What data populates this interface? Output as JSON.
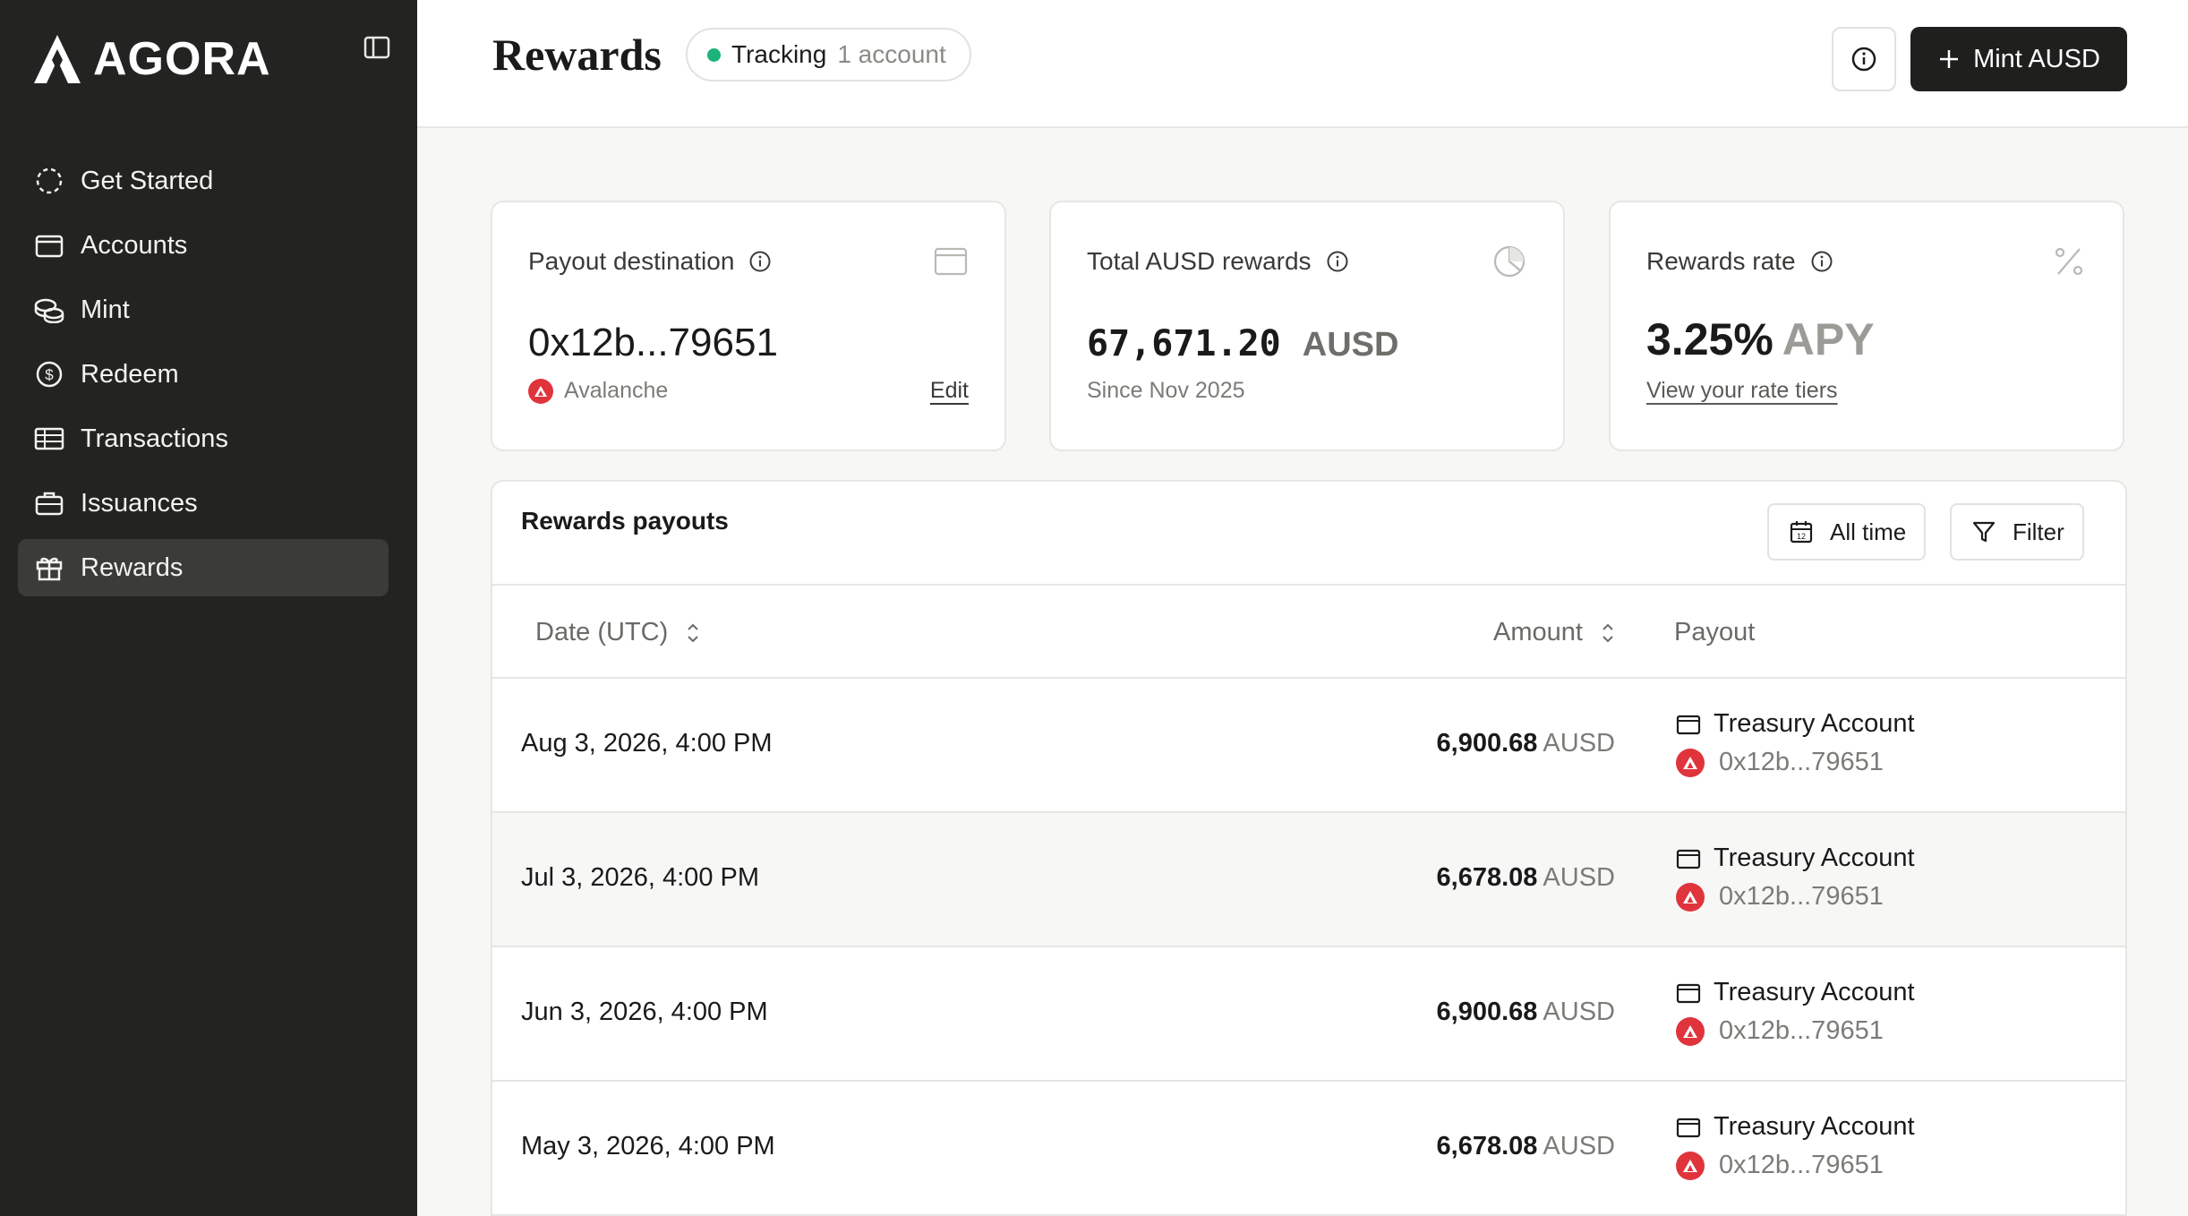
{
  "brand": {
    "name": "AGORA"
  },
  "sidebar": {
    "items": [
      {
        "label": "Get Started",
        "icon": "dashed-circle-icon"
      },
      {
        "label": "Accounts",
        "icon": "wallet-icon"
      },
      {
        "label": "Mint",
        "icon": "coins-icon"
      },
      {
        "label": "Redeem",
        "icon": "dollar-circle-icon"
      },
      {
        "label": "Transactions",
        "icon": "ledger-icon"
      },
      {
        "label": "Issuances",
        "icon": "briefcase-icon"
      },
      {
        "label": "Rewards",
        "icon": "gift-icon",
        "active": true
      }
    ]
  },
  "header": {
    "title": "Rewards",
    "tracking_label": "Tracking",
    "tracking_count": "1 account",
    "mint_button": "Mint AUSD"
  },
  "cards": {
    "payout": {
      "title": "Payout destination",
      "value": "0x12b...79651",
      "network": "Avalanche",
      "edit": "Edit"
    },
    "total": {
      "title": "Total AUSD rewards",
      "value": "67,671.20",
      "unit": "AUSD",
      "since": "Since Nov 2025"
    },
    "rate": {
      "title": "Rewards rate",
      "value": "3.25%",
      "unit": "APY",
      "link": "View your rate tiers"
    }
  },
  "payouts": {
    "title": "Rewards payouts",
    "range_button": "All time",
    "filter_button": "Filter",
    "columns": {
      "date": "Date (UTC)",
      "amount": "Amount",
      "payout": "Payout"
    },
    "rows": [
      {
        "date": "Aug 3, 2026, 4:00 PM",
        "amount": "6,900.68",
        "unit": "AUSD",
        "account": "Treasury Account",
        "address": "0x12b...79651"
      },
      {
        "date": "Jul 3, 2026, 4:00 PM",
        "amount": "6,678.08",
        "unit": "AUSD",
        "account": "Treasury Account",
        "address": "0x12b...79651"
      },
      {
        "date": "Jun 3, 2026, 4:00 PM",
        "amount": "6,900.68",
        "unit": "AUSD",
        "account": "Treasury Account",
        "address": "0x12b...79651"
      },
      {
        "date": "May 3, 2026, 4:00 PM",
        "amount": "6,678.08",
        "unit": "AUSD",
        "account": "Treasury Account",
        "address": "0x12b...79651"
      }
    ]
  },
  "colors": {
    "sidebar": "#232322",
    "accent_green": "#1bb37a",
    "avalanche_red": "#e0343d",
    "primary_button": "#1f1f1e"
  }
}
